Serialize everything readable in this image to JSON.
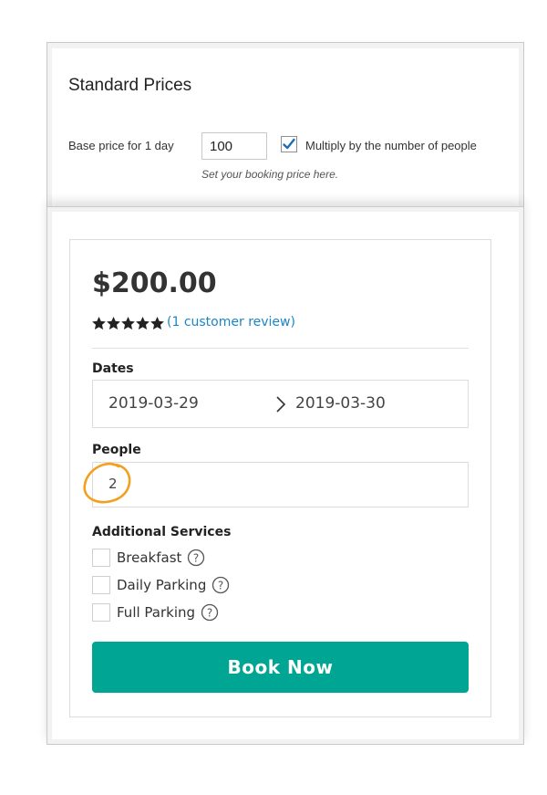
{
  "admin": {
    "title": "Standard Prices",
    "base_price_label": "Base price for 1 day",
    "base_price_value": "100",
    "multiply_checked": true,
    "multiply_label": "Multiply by the number of people",
    "hint": "Set your booking price here."
  },
  "booking": {
    "price": "$200.00",
    "rating": 5,
    "rating_max": 5,
    "review_link": "(1 customer review)",
    "dates_label": "Dates",
    "date_from": "2019-03-29",
    "date_to": "2019-03-30",
    "people_label": "People",
    "people_value": "2",
    "services_label": "Additional Services",
    "services": [
      {
        "label": "Breakfast",
        "checked": false
      },
      {
        "label": "Daily Parking",
        "checked": false
      },
      {
        "label": "Full Parking",
        "checked": false
      }
    ],
    "book_button": "Book Now"
  },
  "colors": {
    "accent": "#00a693",
    "link": "#1a86c8",
    "checkbox_tick": "#1a6fb4",
    "highlight": "#f2a020"
  },
  "icons": {
    "star": "star-icon",
    "arrow": "chevron-right-icon",
    "help": "question-circle-icon",
    "check": "checkmark-icon"
  }
}
